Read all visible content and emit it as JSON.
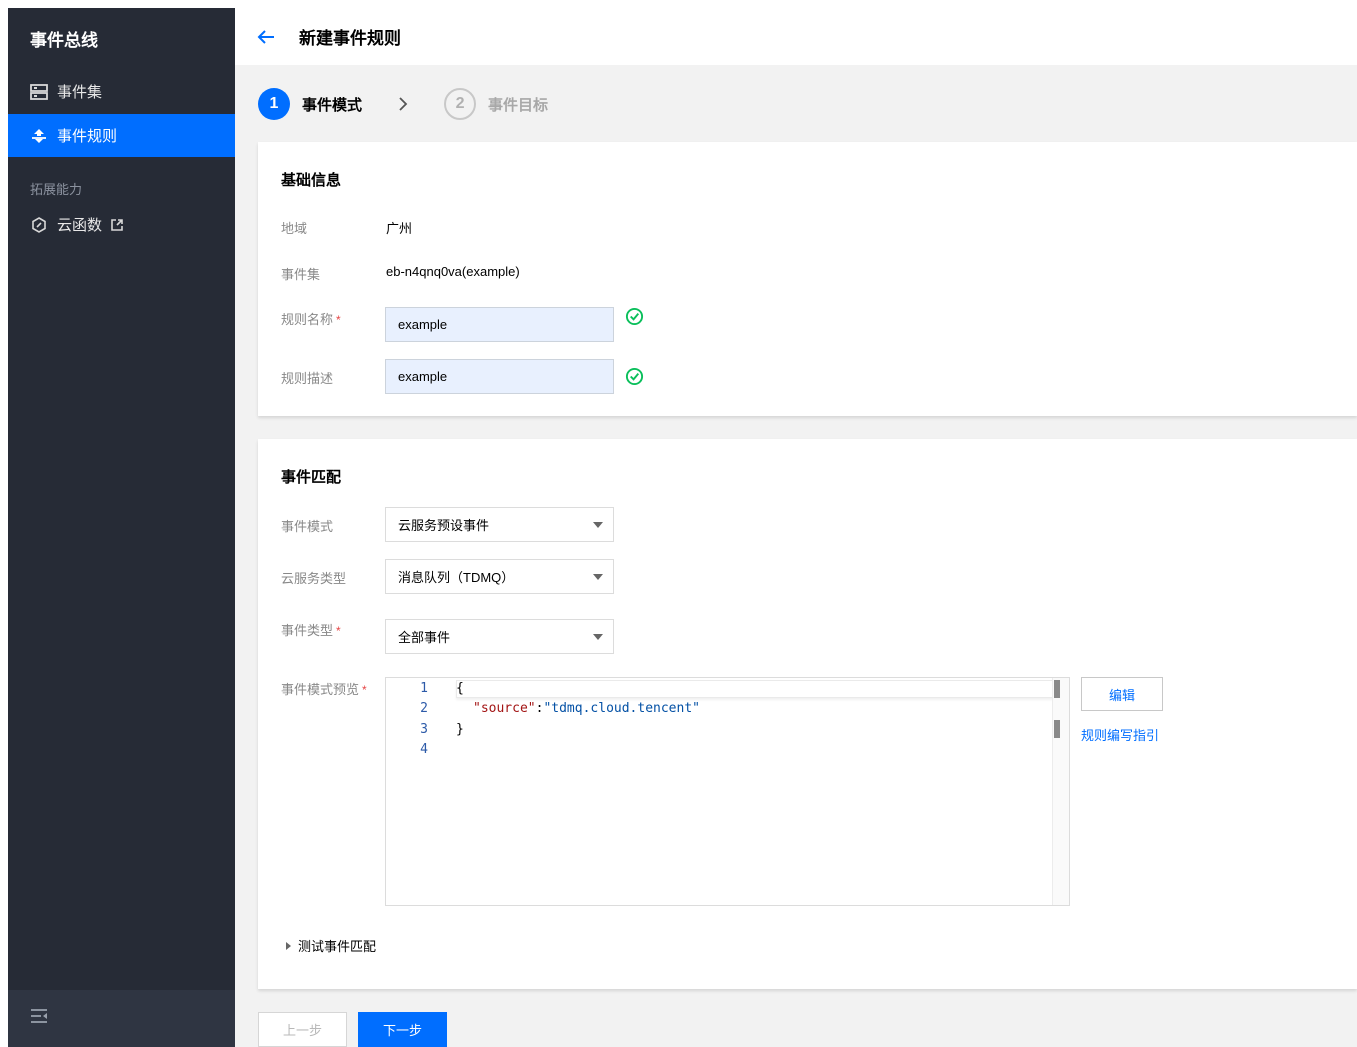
{
  "sidebar": {
    "title": "事件总线",
    "items": [
      {
        "label": "事件集",
        "icon": "event-set-icon"
      },
      {
        "label": "事件规则",
        "icon": "event-rule-icon"
      }
    ],
    "section_label": "拓展能力",
    "ext_items": [
      {
        "label": "云函数",
        "icon": "cloud-function-icon"
      }
    ],
    "active_color": "#006eff"
  },
  "header": {
    "title": "新建事件规则"
  },
  "steps": [
    {
      "number": "1",
      "label": "事件模式"
    },
    {
      "number": "2",
      "label": "事件目标"
    }
  ],
  "basic": {
    "title": "基础信息",
    "region_label": "地域",
    "region_value": "广州",
    "eventset_label": "事件集",
    "eventset_value": "eb-n4qnq0va(example)",
    "name_label": "规则名称",
    "name_value": "example",
    "desc_label": "规则描述",
    "desc_value": "example",
    "required_mark": "*"
  },
  "match": {
    "title": "事件匹配",
    "mode_label": "事件模式",
    "mode_value": "云服务预设事件",
    "service_label": "云服务类型",
    "service_value": "消息队列（TDMQ）",
    "type_label": "事件类型",
    "type_value": "全部事件",
    "preview_label": "事件模式预览",
    "line_numbers": [
      "1",
      "2",
      "3",
      "4"
    ],
    "code_open": "{",
    "code_key": "\"source\"",
    "code_colon": ":",
    "code_value": "\"tdmq.cloud.tencent\"",
    "code_close": "}",
    "edit_label": "编辑",
    "guide_label": "规则编写指引",
    "test_label": "测试事件匹配"
  },
  "footer": {
    "prev_label": "上一步",
    "next_label": "下一步"
  }
}
